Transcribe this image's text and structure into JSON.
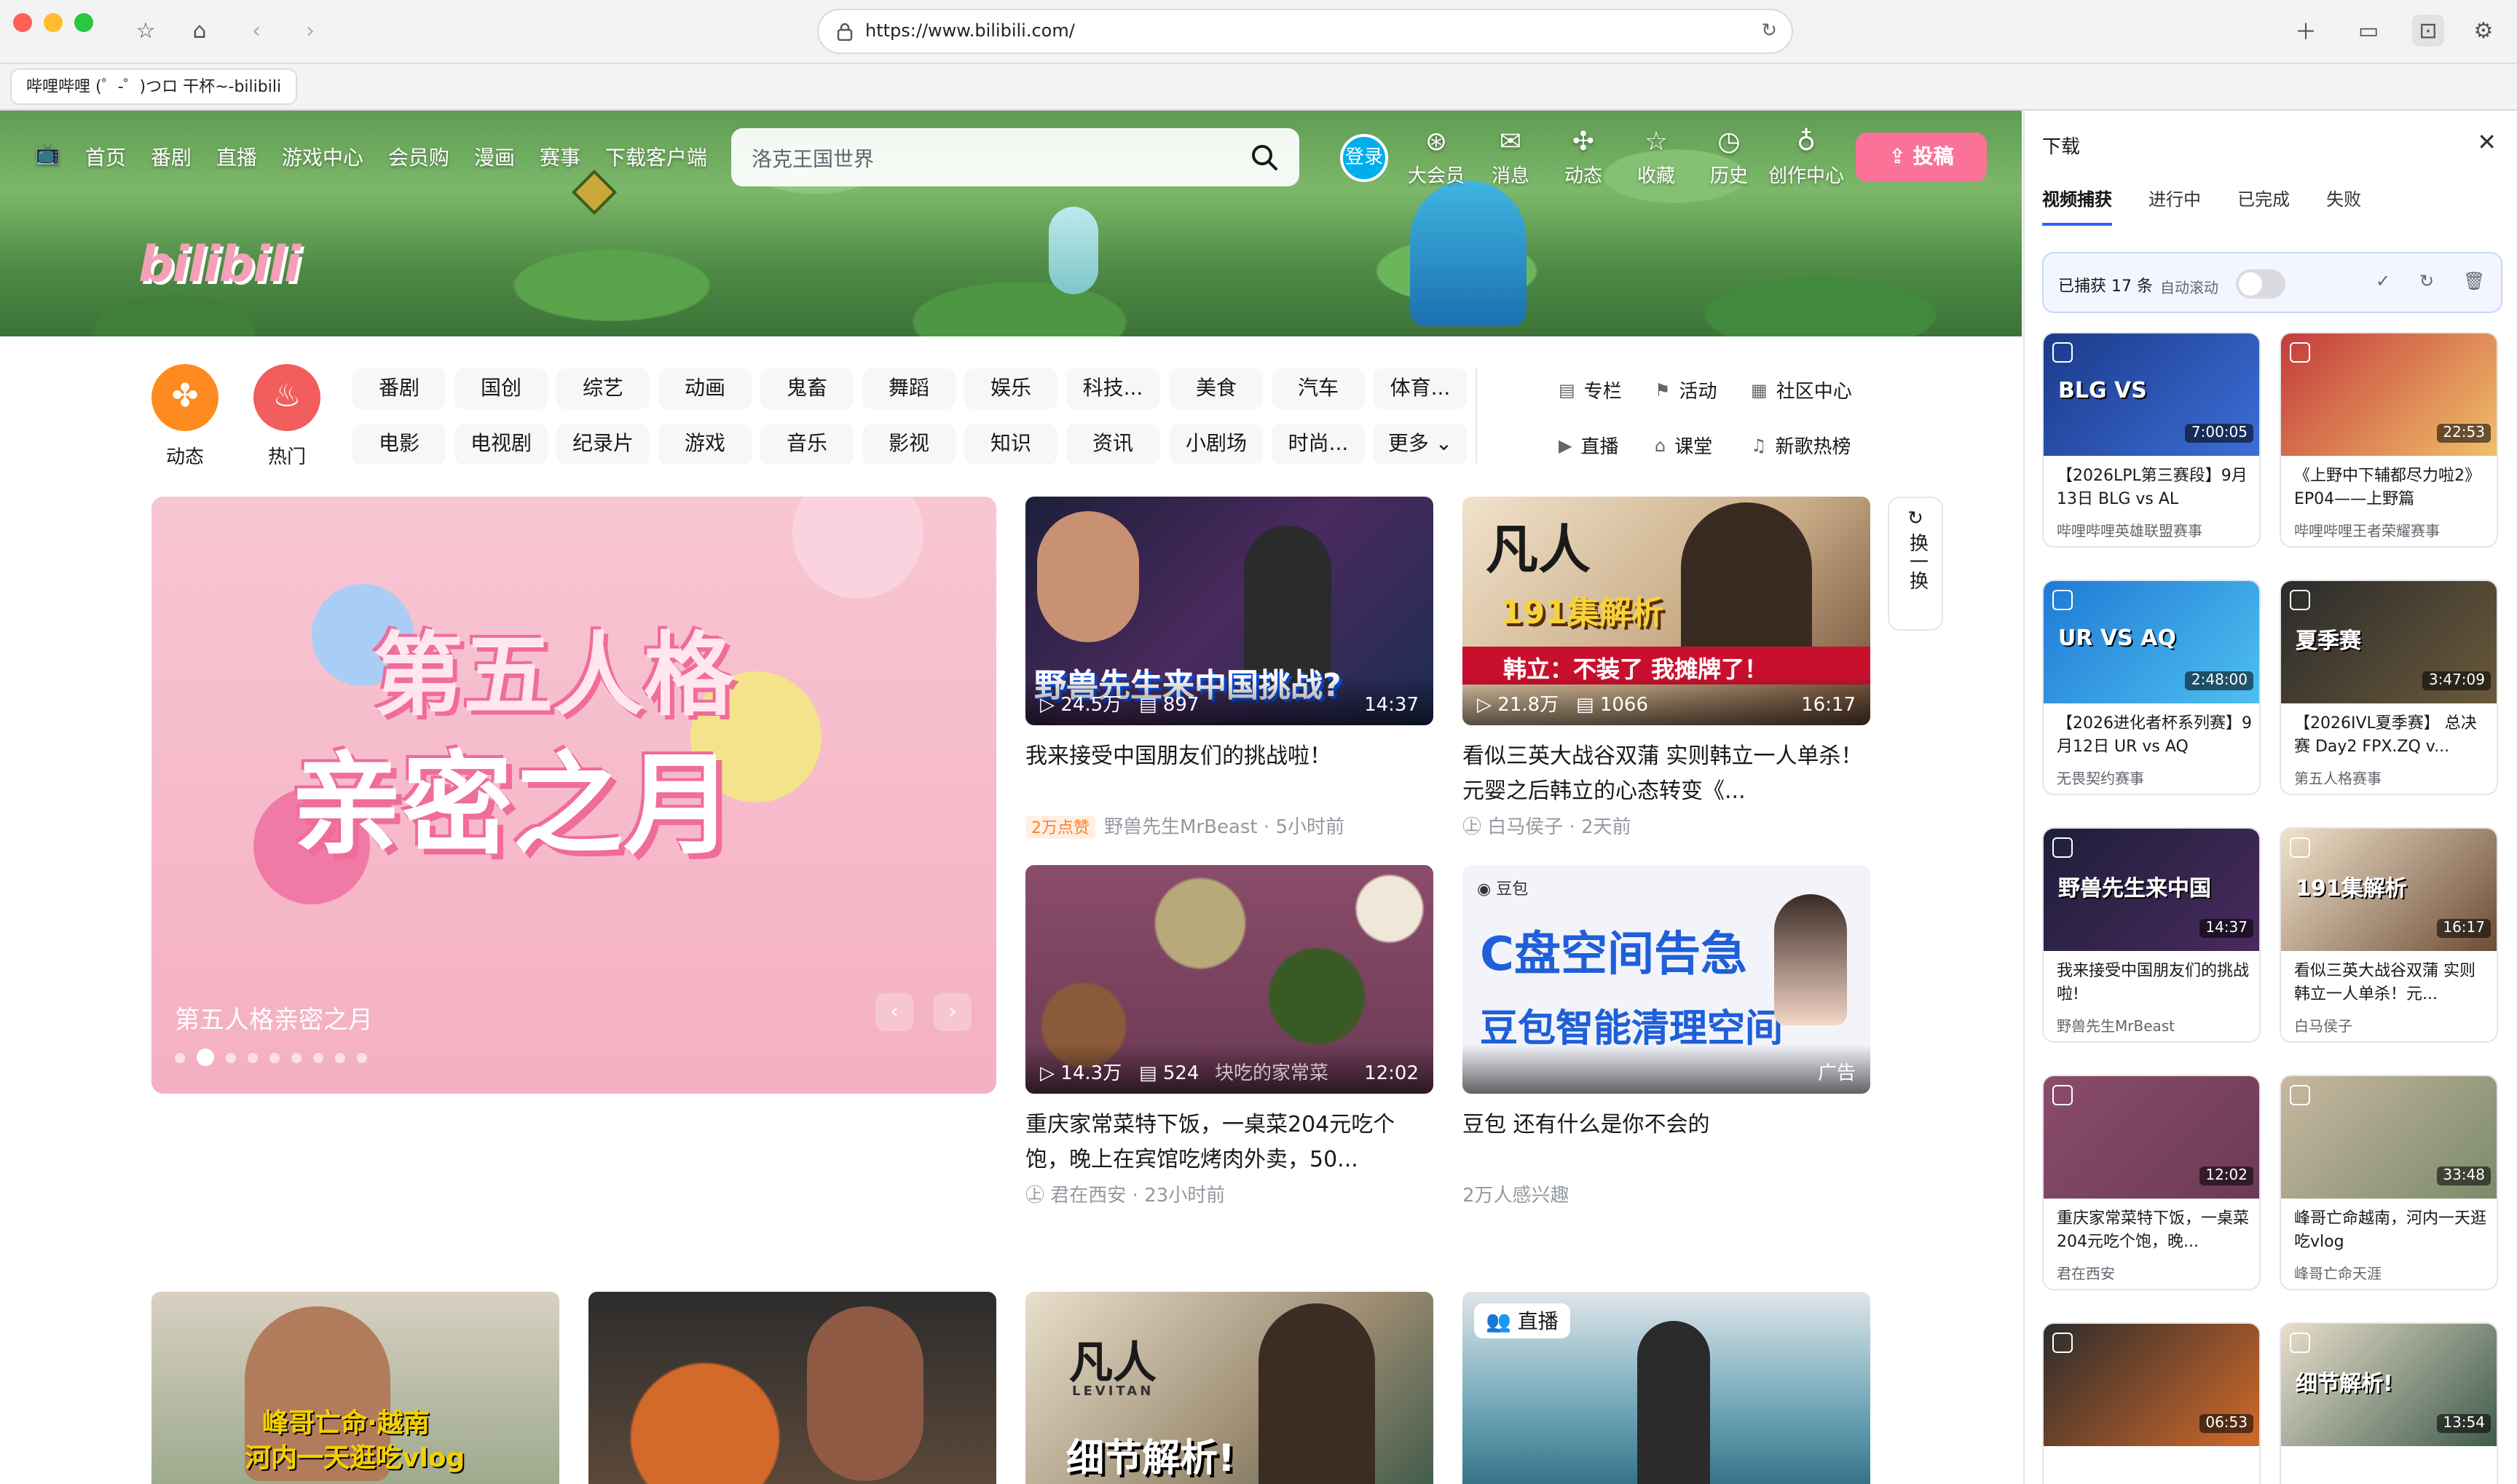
{
  "browser": {
    "url": "https://www.bilibili.com/",
    "tab_title": "哔哩哔哩 (゜-゜)つロ 干杯~-bilibili"
  },
  "header": {
    "nav": [
      "首页",
      "番剧",
      "直播",
      "游戏中心",
      "会员购",
      "漫画",
      "赛事",
      "下载客户端"
    ],
    "search_placeholder": "洛克王国世界",
    "login": "登录",
    "right_icons": [
      {
        "label": "大会员",
        "icon": "vip-icon"
      },
      {
        "label": "消息",
        "icon": "message-icon"
      },
      {
        "label": "动态",
        "icon": "dynamic-icon"
      },
      {
        "label": "收藏",
        "icon": "favorite-icon"
      },
      {
        "label": "历史",
        "icon": "history-icon"
      },
      {
        "label": "创作中心",
        "icon": "creator-icon"
      }
    ],
    "upload": "投稿",
    "logo_text": "bilibili"
  },
  "channels": {
    "round": [
      {
        "label": "动态",
        "color": "#ff8a1f"
      },
      {
        "label": "热门",
        "color": "#f25d5d"
      }
    ],
    "row1": [
      "番剧",
      "国创",
      "综艺",
      "动画",
      "鬼畜",
      "舞蹈",
      "娱乐",
      "科技...",
      "美食",
      "汽车",
      "体育..."
    ],
    "row2": [
      "电影",
      "电视剧",
      "纪录片",
      "游戏",
      "音乐",
      "影视",
      "知识",
      "资讯",
      "小剧场",
      "时尚...",
      "更多"
    ],
    "side_row1": [
      "专栏",
      "活动",
      "社区中心"
    ],
    "side_row2": [
      "直播",
      "课堂",
      "新歌热榜"
    ]
  },
  "carousel": {
    "line1": "第五人格",
    "line2": "亲密之月",
    "caption": "第五人格亲密之月",
    "dots": 9,
    "active": 1
  },
  "refresh": "换一换",
  "cards": [
    {
      "title": "我来接受中国朋友们的挑战啦！",
      "views": "24.5万",
      "danmaku": "897",
      "duration": "14:37",
      "badge": "2万点赞",
      "author": "野兽先生MrBeast",
      "time": "5小时前",
      "overlay": "野兽先生来中国挑战?"
    },
    {
      "title": "看似三英大战谷双蒲 实则韩立一人单杀！元婴之后韩立的心态转变《...",
      "views": "21.8万",
      "danmaku": "1066",
      "duration": "16:17",
      "author": "白马侯子",
      "time": "2天前",
      "overlay1": "凡人",
      "overlay2": "191集解析",
      "overlay3": "韩立：不装了 我摊牌了！"
    },
    {
      "title": "重庆家常菜特下饭，一桌菜204元吃个饱，晚上在宾馆吃烤肉外卖，50...",
      "views": "14.3万",
      "danmaku": "524",
      "duration": "12:02",
      "author": "君在西安",
      "time": "23小时前",
      "overlay": "块吃的家常菜"
    },
    {
      "title": "豆包 还有什么是你不会的",
      "meta": "2万人感兴趣",
      "ad": "广告",
      "brand": "豆包",
      "overlay1": "C盘空间告急",
      "overlay2": "豆包智能清理空间"
    }
  ],
  "bottom_row": {
    "live_badge": "直播",
    "overlay_a": "峰哥亡命·越南",
    "overlay_b": "河内一天逛吃vlog",
    "overlay_c1": "凡人",
    "overlay_c2": "细节解析!",
    "overlay_c3": "LEVITAN"
  },
  "download_panel": {
    "title": "下载",
    "tabs": [
      "视频捕获",
      "进行中",
      "已完成",
      "失败"
    ],
    "active_tab": "视频捕获",
    "captured": "已捕获 17 条",
    "auto_scroll": "自动滚动",
    "auto_scroll_on": false,
    "items": [
      {
        "title": "【2026LPL第三赛段】9月13日 BLG vs AL",
        "author": "哔哩哔哩英雄联盟赛事",
        "duration": "7:00:05",
        "thumb_text": "BLG VS"
      },
      {
        "title": "《上野中下辅都尽力啦2》EP04——上野篇",
        "author": "哔哩哔哩王者荣耀赛事",
        "duration": "22:53",
        "thumb_text": ""
      },
      {
        "title": "【2026进化者杯系列赛】9月12日 UR vs AQ",
        "author": "无畏契约赛事",
        "duration": "2:48:00",
        "thumb_text": "UR VS AQ"
      },
      {
        "title": "【2026IVL夏季赛】 总决赛 Day2 FPX.ZQ v...",
        "author": "第五人格赛事",
        "duration": "3:47:09",
        "thumb_text": "夏季赛"
      },
      {
        "title": "我来接受中国朋友们的挑战啦!",
        "author": "野兽先生MrBeast",
        "duration": "14:37",
        "thumb_text": "野兽先生来中国"
      },
      {
        "title": "看似三英大战谷双蒲 实则韩立一人单杀！元...",
        "author": "白马侯子",
        "duration": "16:17",
        "thumb_text": "191集解析"
      },
      {
        "title": "重庆家常菜特下饭，一桌菜204元吃个饱，晚...",
        "author": "君在西安",
        "duration": "12:02",
        "thumb_text": ""
      },
      {
        "title": "峰哥亡命越南，河内一天逛吃vlog",
        "author": "峰哥亡命天涯",
        "duration": "33:48",
        "thumb_text": ""
      },
      {
        "title": "",
        "author": "",
        "duration": "06:53",
        "thumb_text": ""
      },
      {
        "title": "",
        "author": "",
        "duration": "13:54",
        "thumb_text": "细节解析!"
      }
    ]
  }
}
